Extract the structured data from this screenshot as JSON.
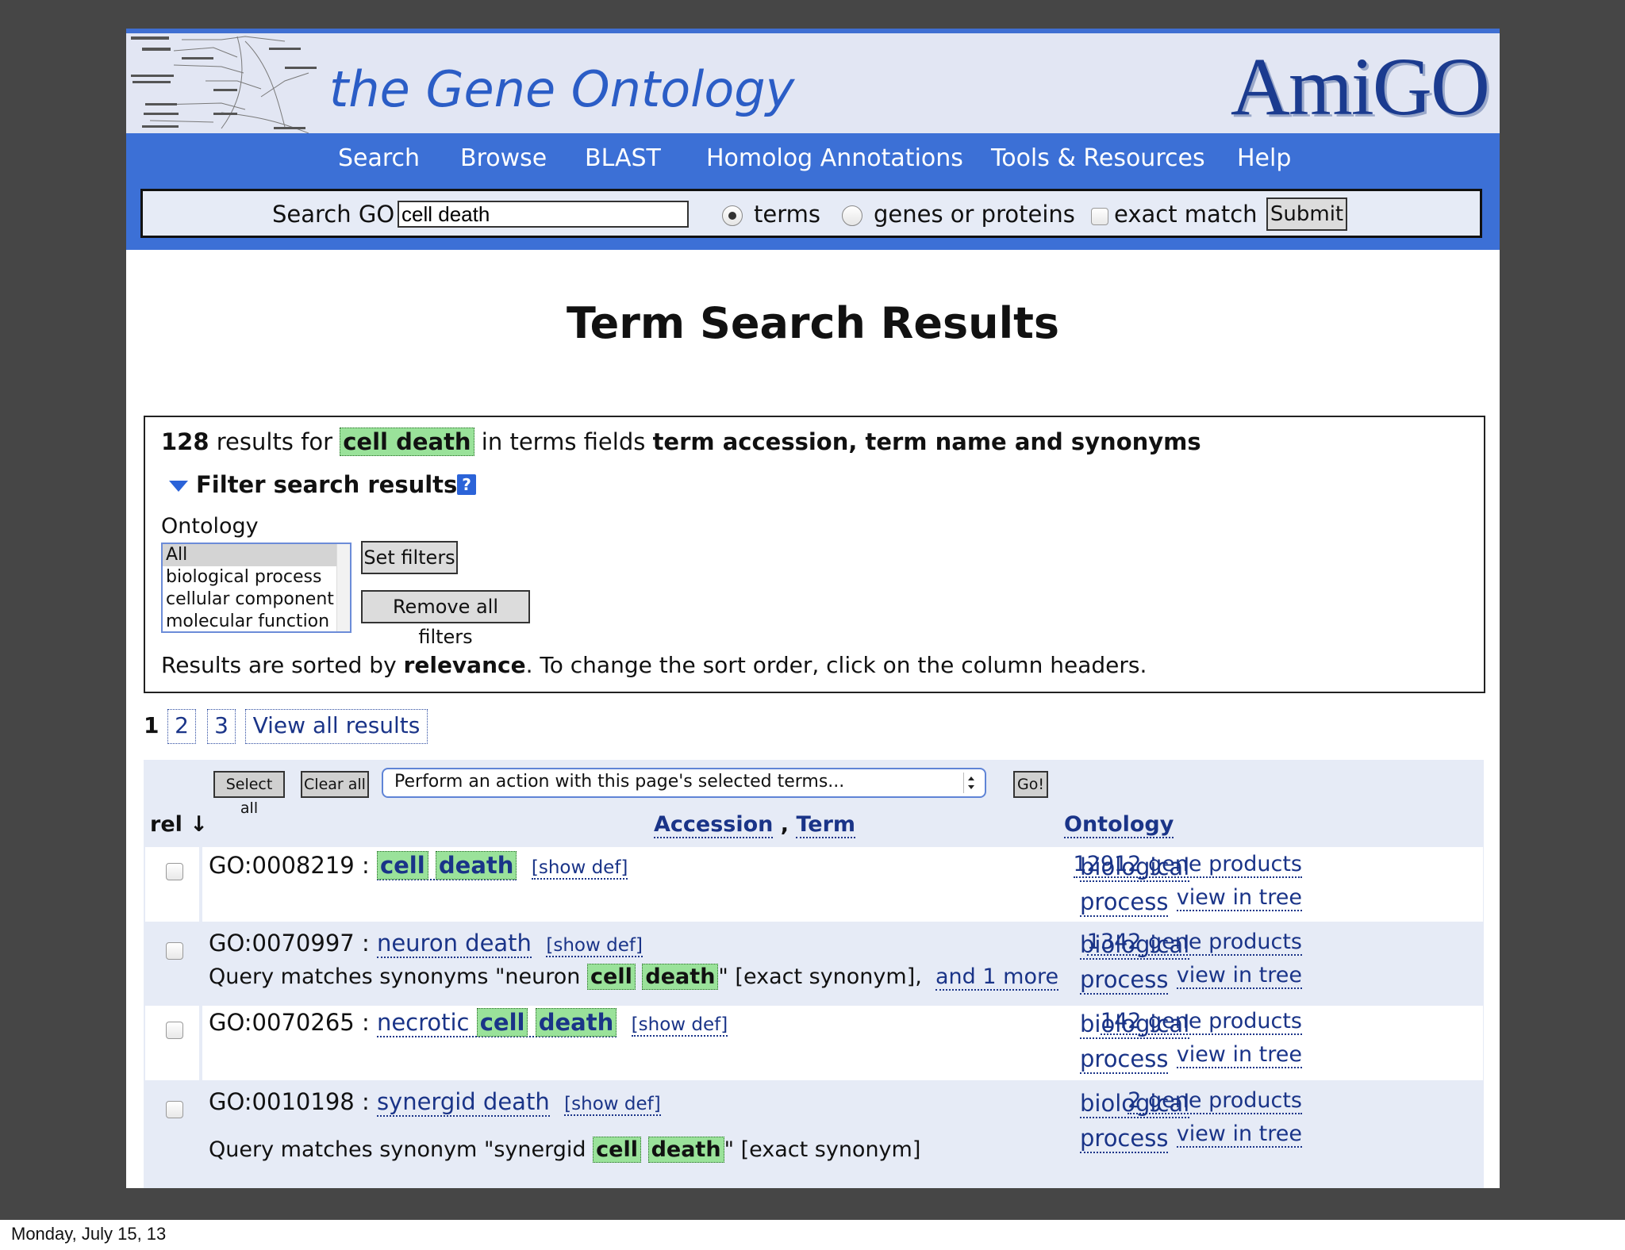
{
  "slide": {
    "date": "Monday, July 15, 13"
  },
  "header": {
    "site_title": "the Gene Ontology",
    "logo": "AmiGO"
  },
  "nav": {
    "items": [
      "Search",
      "Browse",
      "BLAST",
      "Homolog Annotations",
      "Tools & Resources",
      "Help"
    ]
  },
  "search": {
    "label": "Search GO",
    "value": "cell death",
    "radio_terms": "terms",
    "radio_genes": "genes or proteins",
    "exact_match": "exact match",
    "submit": "Submit",
    "selected": "terms"
  },
  "page_title": "Term Search Results",
  "summary": {
    "count": "128",
    "results_for": "results for",
    "query": "cell death",
    "in_terms_fields": "in terms fields",
    "fields": "term accession, term name and synonyms",
    "filter_heading": "Filter search results",
    "help": "?",
    "ontology_label": "Ontology",
    "ontology_options": [
      "All",
      "biological process",
      "cellular component",
      "molecular function"
    ],
    "selected_option": "All",
    "set_filters": "Set filters",
    "remove_filters": "Remove all filters",
    "sort_pre": "Results are sorted by",
    "sort_key": "relevance",
    "sort_post": ". To change the sort order, click on the column headers."
  },
  "pagination": {
    "current": "1",
    "pages": [
      "2",
      "3"
    ],
    "view_all": "View all results"
  },
  "results": {
    "select_all": "Select all",
    "clear_all": "Clear all",
    "action_placeholder": "Perform an action with this page's selected terms...",
    "go": "Go!",
    "col_rel": "rel ↓",
    "col_accession": "Accession",
    "col_comma": ",",
    "col_term": "Term",
    "col_ontology": "Ontology",
    "show_def": "[show def]",
    "view_in_tree": "view in tree",
    "rows": [
      {
        "accession": "GO:0008219",
        "sep": ":",
        "term_pre": "",
        "term_hl1": "cell",
        "term_hl2": "death",
        "gene_products": "12912 gene products",
        "ontology_1": "biological",
        "ontology_2": "process"
      },
      {
        "accession": "GO:0070997",
        "sep": ":",
        "term_pre": "neuron death",
        "syn_pre": "Query matches synonyms  \"neuron",
        "syn_hl1": "cell",
        "syn_hl2": "death",
        "syn_post": "\" [exact synonym],",
        "more": "and 1 more",
        "gene_products": "1342 gene products",
        "ontology_1": "biological",
        "ontology_2": "process"
      },
      {
        "accession": "GO:0070265",
        "sep": ":",
        "term_pre": "necrotic",
        "term_hl1": "cell",
        "term_hl2": "death",
        "gene_products": "142 gene products",
        "ontology_1": "biological",
        "ontology_2": "process"
      },
      {
        "accession": "GO:0010198",
        "sep": ":",
        "term_pre": "synergid death",
        "syn_pre": "Query matches synonym \"synergid",
        "syn_hl1": "cell",
        "syn_hl2": "death",
        "syn_post": "\" [exact synonym]",
        "gene_products": "2 gene products",
        "ontology_1": "biological",
        "ontology_2": "process"
      }
    ]
  },
  "colors": {
    "nav_blue": "#3c70d6",
    "title_blue": "#2b5dc6",
    "link_blue": "#1a3488",
    "highlight_green": "#9ae29a",
    "panel_bg": "#e6ebf6"
  }
}
